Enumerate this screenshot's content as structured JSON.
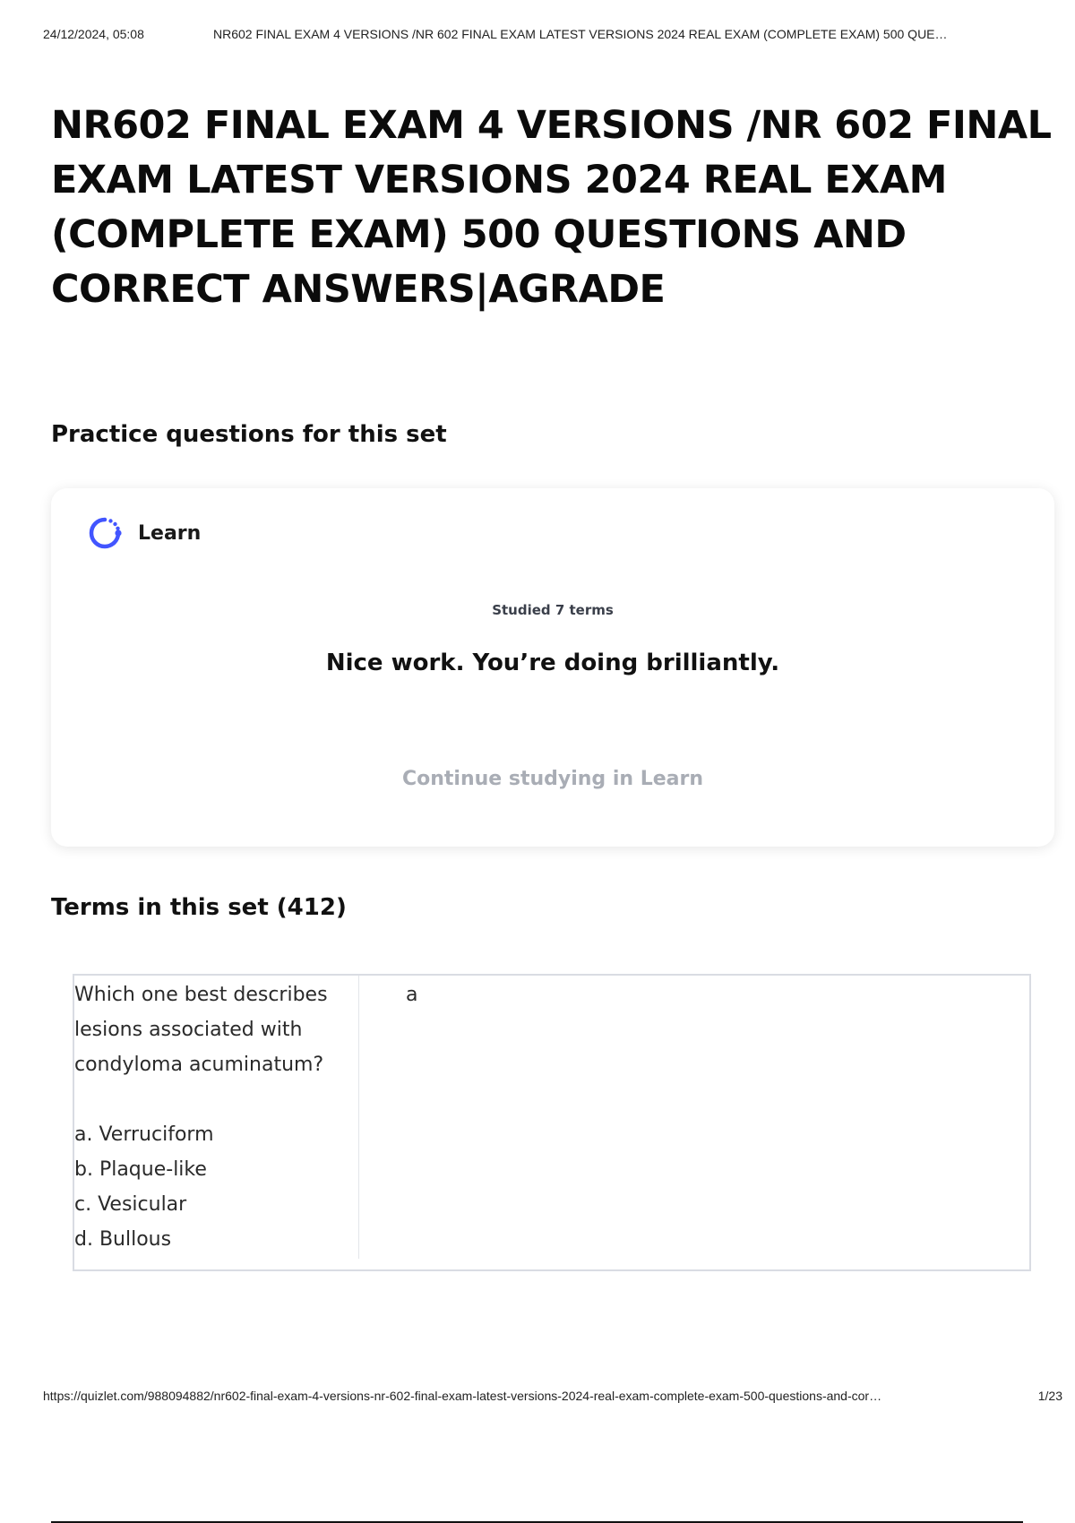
{
  "print_header": {
    "date": "24/12/2024, 05:08",
    "title": "NR602 FINAL EXAM 4 VERSIONS /NR 602 FINAL EXAM LATEST VERSIONS 2024 REAL EXAM (COMPLETE EXAM) 500 QUE…"
  },
  "document": {
    "title": "NR602 FINAL EXAM 4 VERSIONS /NR 602 FINAL EXAM LATEST VERSIONS 2024 REAL EXAM (COMPLETE EXAM) 500 QUESTIONS AND CORRECT ANSWERS|AGRADE"
  },
  "practice": {
    "heading": "Practice questions for this set",
    "learn_label": "Learn",
    "learn_icon": "learn-progress-icon",
    "studied": "Studied 7 terms",
    "message": "Nice work. You’re doing brilliantly.",
    "continue_label": "Continue studying in Learn",
    "accent_color": "#4255ff"
  },
  "terms": {
    "heading": "Terms in this set (412)",
    "items": [
      {
        "question": "Which one best describes lesions associated with condyloma acuminatum?",
        "options": [
          "a. Verruciform",
          "b. Plaque-like",
          "c. Vesicular",
          "d. Bullous"
        ],
        "answer": "a"
      }
    ]
  },
  "print_footer": {
    "url": "https://quizlet.com/988094882/nr602-final-exam-4-versions-nr-602-final-exam-latest-versions-2024-real-exam-complete-exam-500-questions-and-cor…",
    "page": "1/23"
  }
}
